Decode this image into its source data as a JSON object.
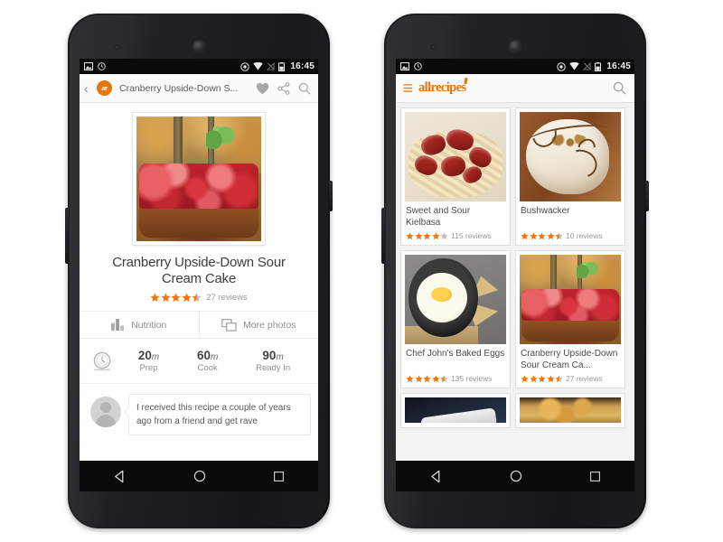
{
  "meta": {
    "scene": "Two Android phones side by side showing the Allrecipes mobile app",
    "accent_color": "#e8740c",
    "star_color": "#f2760b",
    "star_empty_color": "#bdbdbd"
  },
  "status_bar": {
    "time": "16:45",
    "left_icons": [
      "screenshot-icon",
      "alarm-icon"
    ],
    "right_icons": [
      "location-icon",
      "wifi-icon",
      "signal-off-icon",
      "battery-icon"
    ]
  },
  "nav_bar": {
    "back_label": "Back",
    "home_label": "Home",
    "recents_label": "Recent apps"
  },
  "phone_left": {
    "app_bar": {
      "back_icon": "back-chevron-icon",
      "logo_text": "ar",
      "title": "Cranberry Upside-Down S...",
      "actions": [
        {
          "name": "favorite-button",
          "icon": "heart-icon"
        },
        {
          "name": "share-button",
          "icon": "share-icon"
        },
        {
          "name": "search-button",
          "icon": "search-icon"
        }
      ]
    },
    "recipe": {
      "title": "Cranberry Upside-Down Sour Cream Cake",
      "rating": 4.5,
      "reviews": "27 reviews",
      "hero_alt": "Cranberry upside-down cake topped with mint in an autumn forest"
    },
    "actions": [
      {
        "name": "nutrition-button",
        "icon": "bar-chart-icon",
        "label": "Nutrition"
      },
      {
        "name": "more-photos-button",
        "icon": "photos-stack-icon",
        "label": "More photos"
      }
    ],
    "times": {
      "icon": "stopwatch-icon",
      "items": [
        {
          "value": "20",
          "unit": "m",
          "label": "Prep"
        },
        {
          "value": "60",
          "unit": "m",
          "label": "Cook"
        },
        {
          "value": "90",
          "unit": "m",
          "label": "Ready In"
        }
      ]
    },
    "review": {
      "avatar": "user-avatar-placeholder",
      "text": "I received this recipe a couple of years ago from a friend and get rave"
    }
  },
  "phone_right": {
    "app_bar": {
      "menu_icon": "hamburger-menu-icon",
      "brand": "allrecipes",
      "search_icon": "search-icon"
    },
    "cards": [
      {
        "title": "Sweet and Sour Kielbasa",
        "rating": 4,
        "reviews": "115 reviews",
        "image": "kielbasa",
        "image_alt": "Kielbasa sausage slices over egg noodles"
      },
      {
        "title": "Bushwacker",
        "rating": 4.5,
        "reviews": "10 reviews",
        "image": "bushwacker",
        "image_alt": "Creamy white cocktail in a decorated glass"
      },
      {
        "title": "Chef John's Baked Eggs",
        "rating": 4.5,
        "reviews": "135 reviews",
        "image": "eggs",
        "image_alt": "Baked eggs in a cast iron skillet with pita chips"
      },
      {
        "title": "Cranberry Upside-Down Sour Cream Ca...",
        "rating": 4.5,
        "reviews": "27 reviews",
        "image": "cake",
        "image_alt": "Cranberry upside-down sour cream cake"
      }
    ],
    "partial_cards": [
      {
        "image": "dark",
        "image_alt": "Partially visible recipe photo"
      },
      {
        "image": "bread",
        "image_alt": "Partially visible baked dish photo"
      }
    ]
  }
}
